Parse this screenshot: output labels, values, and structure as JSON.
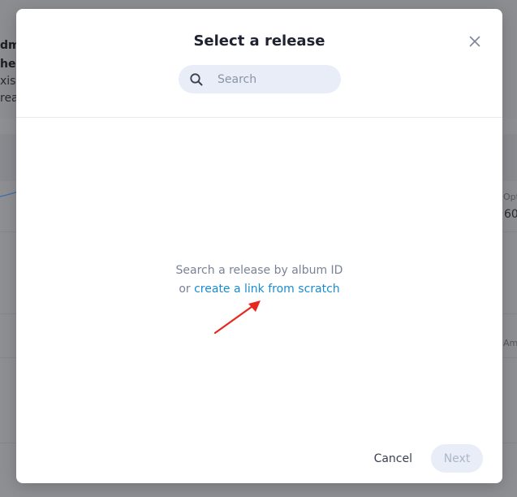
{
  "background": {
    "fragments": [
      {
        "text": "dm",
        "style": "bold"
      },
      {
        "text": "he r",
        "style": "bold"
      },
      {
        "text": "xist",
        "style": "normal"
      },
      {
        "text": "reat",
        "style": "normal"
      },
      {
        "text": "Opt",
        "style": "muted"
      },
      {
        "text": "60",
        "style": "normal"
      },
      {
        "text": "Am",
        "style": "muted"
      }
    ]
  },
  "modal": {
    "title": "Select a release",
    "close_icon": "close-icon",
    "search": {
      "placeholder": "Search",
      "value": "",
      "icon": "search-icon"
    },
    "empty_state": {
      "line1": "Search a release by album ID",
      "prefix": "or",
      "link_label": "create a link from scratch"
    },
    "annotation": {
      "arrow_color": "#e8281f"
    },
    "footer": {
      "cancel_label": "Cancel",
      "next_label": "Next"
    }
  },
  "colors": {
    "link": "#1b8bd1",
    "search_bg": "#e8edf8",
    "next_disabled_text": "#aeb6c8"
  }
}
